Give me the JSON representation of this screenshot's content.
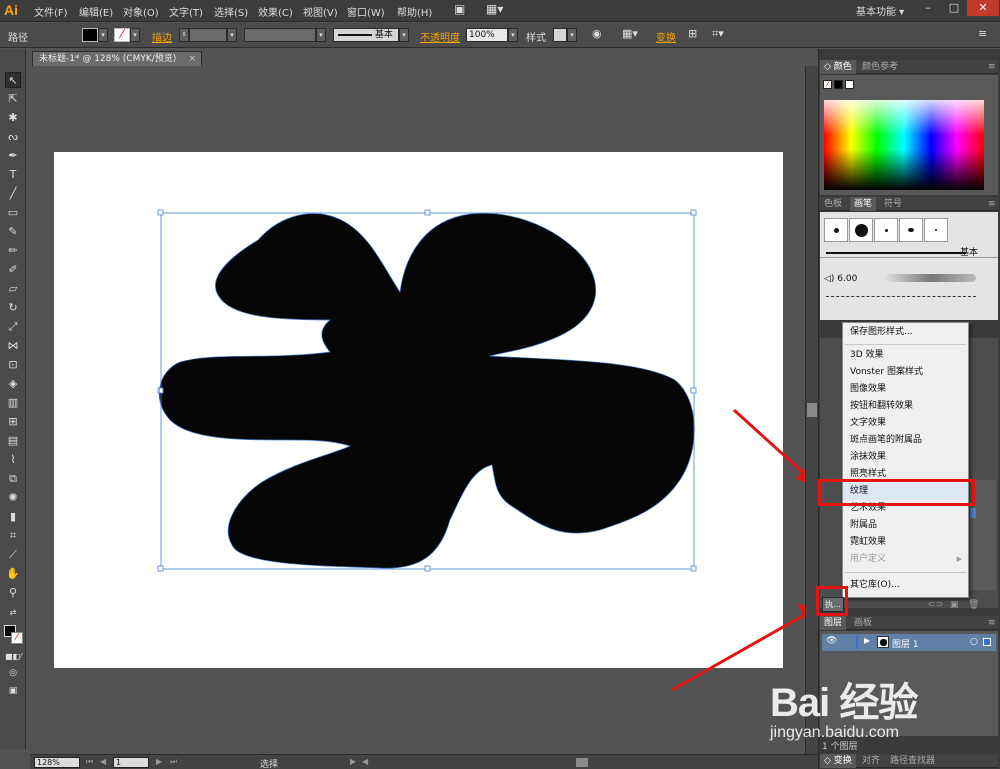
{
  "app": {
    "logo": "Ai",
    "menus": [
      "文件(F)",
      "编辑(E)",
      "对象(O)",
      "文字(T)",
      "选择(S)",
      "效果(C)",
      "视图(V)",
      "窗口(W)",
      "帮助(H)"
    ],
    "workspace": "基本功能"
  },
  "controlbar": {
    "object_type": "路径",
    "stroke_label": "描边",
    "stroke_style": "基本",
    "opacity_label": "不透明度",
    "opacity_value": "100%",
    "style_label": "样式",
    "transform_label": "变换"
  },
  "document": {
    "tab_title": "未标题-1* @ 128% (CMYK/预览)",
    "close_glyph": "×"
  },
  "status": {
    "zoom": "128%",
    "page": "1",
    "tool": "选择"
  },
  "panels": {
    "color_tabs": [
      "颜色",
      "颜色参考"
    ],
    "brush_tabs": [
      "色板",
      "画笔",
      "符号"
    ],
    "brush_style_label": "基本",
    "brush_size": "6.00",
    "library_button": "执...",
    "layer_tabs": [
      "图层",
      "画板"
    ],
    "layer_name": "图层 1",
    "layers_count": "1 个图层",
    "bottom_tabs": [
      "变换",
      "对齐",
      "路径查找器"
    ]
  },
  "graphic_styles_menu": {
    "items": [
      {
        "label": "保存图形样式...",
        "state": "normal"
      },
      {
        "label": "3D 效果",
        "state": "normal"
      },
      {
        "label": "Vonster 图案样式",
        "state": "normal"
      },
      {
        "label": "图像效果",
        "state": "normal"
      },
      {
        "label": "按钮和翻转效果",
        "state": "normal"
      },
      {
        "label": "文字效果",
        "state": "normal"
      },
      {
        "label": "斑点画笔的附属品",
        "state": "normal"
      },
      {
        "label": "涂抹效果",
        "state": "normal"
      },
      {
        "label": "照亮样式",
        "state": "normal"
      },
      {
        "label": "纹理",
        "state": "highlighted"
      },
      {
        "label": "艺术效果",
        "state": "normal"
      },
      {
        "label": "附属品",
        "state": "normal"
      },
      {
        "label": "霓虹效果",
        "state": "normal"
      },
      {
        "label": "用户定义",
        "state": "disabled"
      },
      {
        "label": "其它库(O)...",
        "state": "normal"
      }
    ]
  },
  "watermark": {
    "logo": "Bai 经验",
    "url": "jingyan.baidu.com"
  },
  "colors": {
    "accent_orange": "#f7a400",
    "annotation_red": "#e31414",
    "selection_blue": "#4a7fd8",
    "shape_fill": "#050505"
  }
}
